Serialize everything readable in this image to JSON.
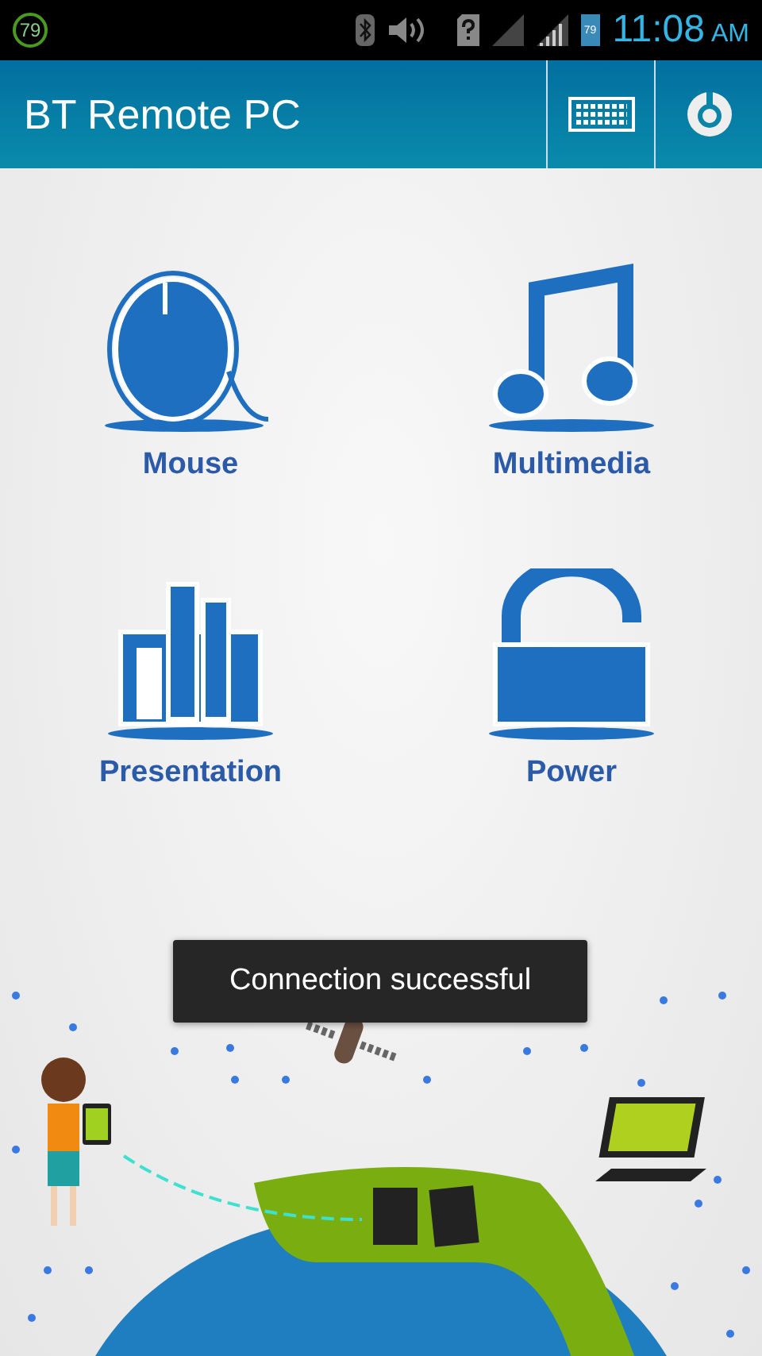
{
  "status_bar": {
    "badge": "79",
    "battery": "79",
    "time": "11:08",
    "meridiem": "AM"
  },
  "app_bar": {
    "title": "BT Remote PC"
  },
  "tiles": [
    {
      "kind": "mouse",
      "label": "Mouse"
    },
    {
      "kind": "music",
      "label": "Multimedia"
    },
    {
      "kind": "chart",
      "label": "Presentation"
    },
    {
      "kind": "lock",
      "label": "Power"
    }
  ],
  "toast": {
    "text": "Connection successful"
  }
}
